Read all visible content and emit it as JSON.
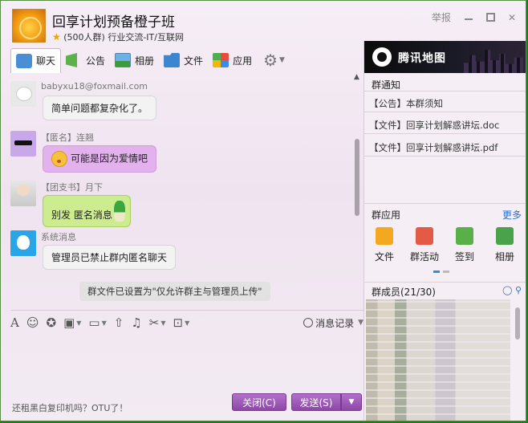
{
  "window": {
    "group_name": "回享计划预备橙子班",
    "group_sub": "(500人群) 行业交流-IT/互联网",
    "report_label": "举报"
  },
  "tabs": [
    {
      "label": "聊天",
      "icon": "chat-icon"
    },
    {
      "label": "公告",
      "icon": "notice-icon"
    },
    {
      "label": "相册",
      "icon": "album-icon"
    },
    {
      "label": "文件",
      "icon": "folder-icon"
    },
    {
      "label": "应用",
      "icon": "apps-icon"
    }
  ],
  "messages": [
    {
      "sender": "babyxu18@foxmail.com",
      "text": "简单问题都复杂化了。"
    },
    {
      "sender": "【匿名】连翘",
      "text": "可能是因为爱情吧"
    },
    {
      "sender": "【团支书】月下",
      "text": "别发 匿名消息"
    },
    {
      "sender": "系统消息",
      "text": "管理员已禁止群内匿名聊天"
    }
  ],
  "system_note": "群文件已设置为\"仅允许群主与管理员上传\"",
  "toolbar": {
    "history_label": "消息记录"
  },
  "footer": {
    "promo": "还租黑白复印机吗？OTU了！",
    "close_label": "关闭(C)",
    "send_label": "发送(S)"
  },
  "right_panel": {
    "map_banner": "腾讯地图",
    "notices_title": "群通知",
    "notices": [
      "【公告】本群须知",
      "【文件】回享计划解惑讲坛.doc",
      "【文件】回享计划解惑讲坛.pdf"
    ],
    "apps_title": "群应用",
    "more_label": "更多",
    "apps": [
      "文件",
      "群活动",
      "签到",
      "相册"
    ],
    "members_title": "群成员(21/30)"
  }
}
